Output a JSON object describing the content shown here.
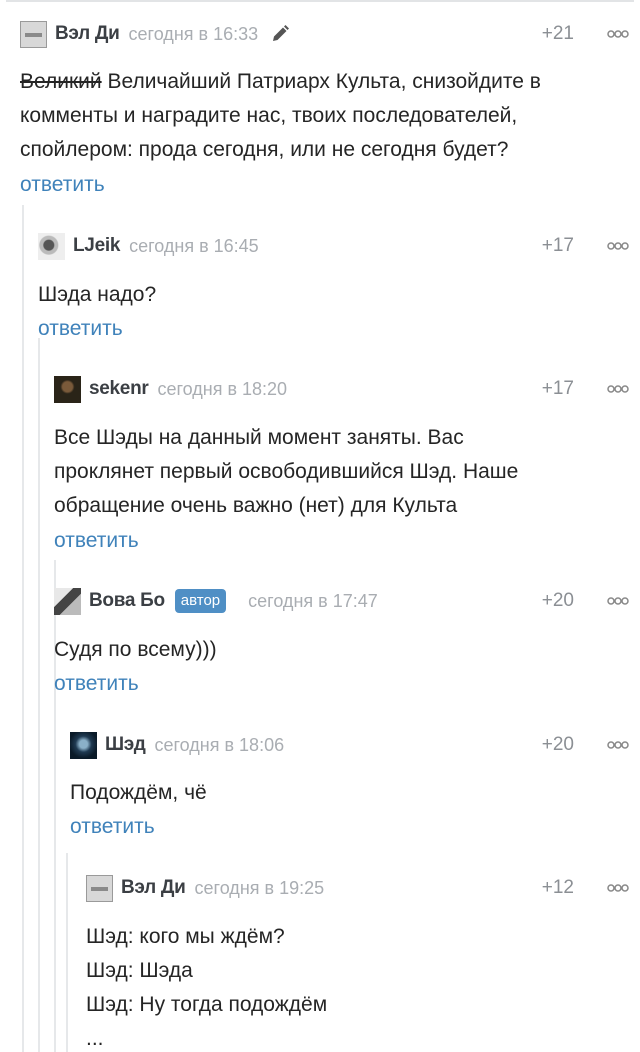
{
  "comments": [
    {
      "author": "Вэл Ди",
      "time": "сегодня в 16:33",
      "rating": "+21",
      "text_strike": "Великий",
      "text_lines": [
        " Величайший Патриарх Культа, снизойдите в",
        "комменты и наградите нас, твоих последователей,",
        "спойлером: прода сегодня, или не сегодня будет?"
      ],
      "reply": "ответить",
      "icons": [
        "pencil-icon",
        "more-icon"
      ]
    },
    {
      "author": "LJeik",
      "time": "сегодня в 16:45",
      "rating": "+17",
      "text_lines": [
        "Шэда надо?"
      ],
      "reply": "ответить"
    },
    {
      "author": "sekenr",
      "time": "сегодня в 18:20",
      "rating": "+17",
      "text_lines": [
        "Все Шэды на данный момент заняты. Вас",
        "проклянет первый освободившийся Шэд. Наше",
        "обращение очень важно (нет) для Культа"
      ],
      "reply": "ответить"
    },
    {
      "author": "Вова Бо",
      "badge": "автор",
      "time": "сегодня в 17:47",
      "rating": "+20",
      "text_lines": [
        "Судя по всему)))"
      ],
      "reply": "ответить"
    },
    {
      "author": "Шэд",
      "time": "сегодня в 18:06",
      "rating": "+20",
      "text_lines": [
        "Подождём, чё"
      ],
      "reply": "ответить"
    },
    {
      "author": "Вэл Ди",
      "time": "сегодня в 19:25",
      "rating": "+12",
      "text_lines": [
        "Шэд: кого мы ждём?",
        "Шэд: Шэда",
        "Шэд: Ну тогда подождём",
        "..."
      ]
    }
  ],
  "colors": {
    "link": "#3f82ba",
    "badge_bg": "#4f8fc5",
    "meta": "#a9adb2",
    "thread_line": "#e6e8ea"
  }
}
